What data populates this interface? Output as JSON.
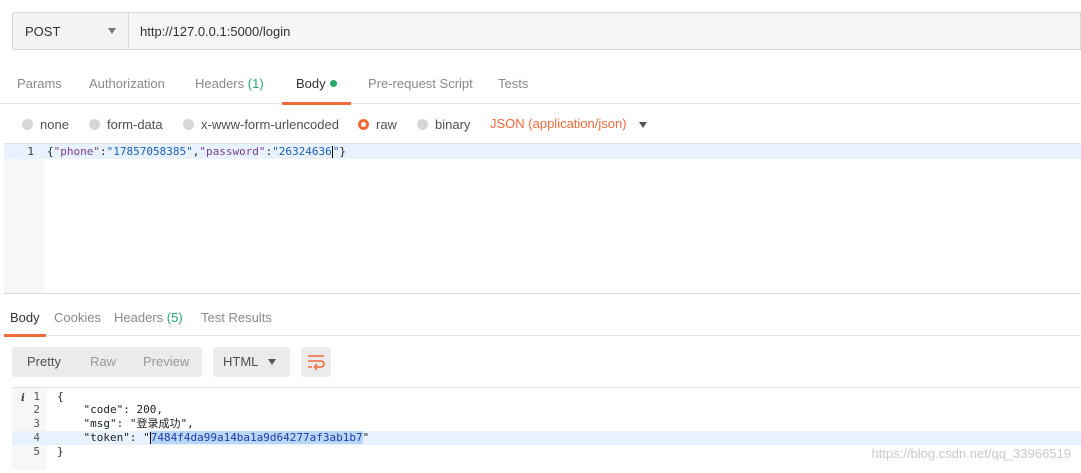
{
  "request": {
    "method": "POST",
    "url": "http://127.0.0.1:5000/login"
  },
  "request_tabs": [
    {
      "label": "Params"
    },
    {
      "label": "Authorization"
    },
    {
      "label": "Headers",
      "count": "(1)"
    },
    {
      "label": "Body"
    },
    {
      "label": "Pre-request Script"
    },
    {
      "label": "Tests"
    }
  ],
  "body_types": [
    {
      "label": "none"
    },
    {
      "label": "form-data"
    },
    {
      "label": "x-www-form-urlencoded"
    },
    {
      "label": "raw"
    },
    {
      "label": "binary"
    }
  ],
  "content_type": "JSON (application/json)",
  "request_body": {
    "line_no": "1",
    "open": "{",
    "k1": "\"phone\"",
    "c1": ":",
    "v1": "\"17857058385\"",
    "comma": ",",
    "k2": "\"password\"",
    "c2": ":",
    "v2a": "\"26324636",
    "v2b": "\"",
    "close": "}"
  },
  "response_tabs": [
    {
      "label": "Body"
    },
    {
      "label": "Cookies"
    },
    {
      "label": "Headers",
      "count": "(5)"
    },
    {
      "label": "Test Results"
    }
  ],
  "view_modes": [
    "Pretty",
    "Raw",
    "Preview"
  ],
  "format": "HTML",
  "response_lines": [
    {
      "no": "1",
      "text": "{"
    },
    {
      "no": "2",
      "text": "    \"code\": 200,"
    },
    {
      "no": "3",
      "text": "    \"msg\": \"登录成功\","
    },
    {
      "no": "4",
      "pre": "    \"token\": \"",
      "sel": "7484f4da99a14ba1a9d64277af3ab1b7",
      "post": "\""
    },
    {
      "no": "5",
      "text": "}"
    }
  ],
  "info_marker": "i",
  "watermark": "https://blog.csdn.net/qq_33966519",
  "colors": {
    "accent": "#f26b3a",
    "green": "#26a569"
  }
}
